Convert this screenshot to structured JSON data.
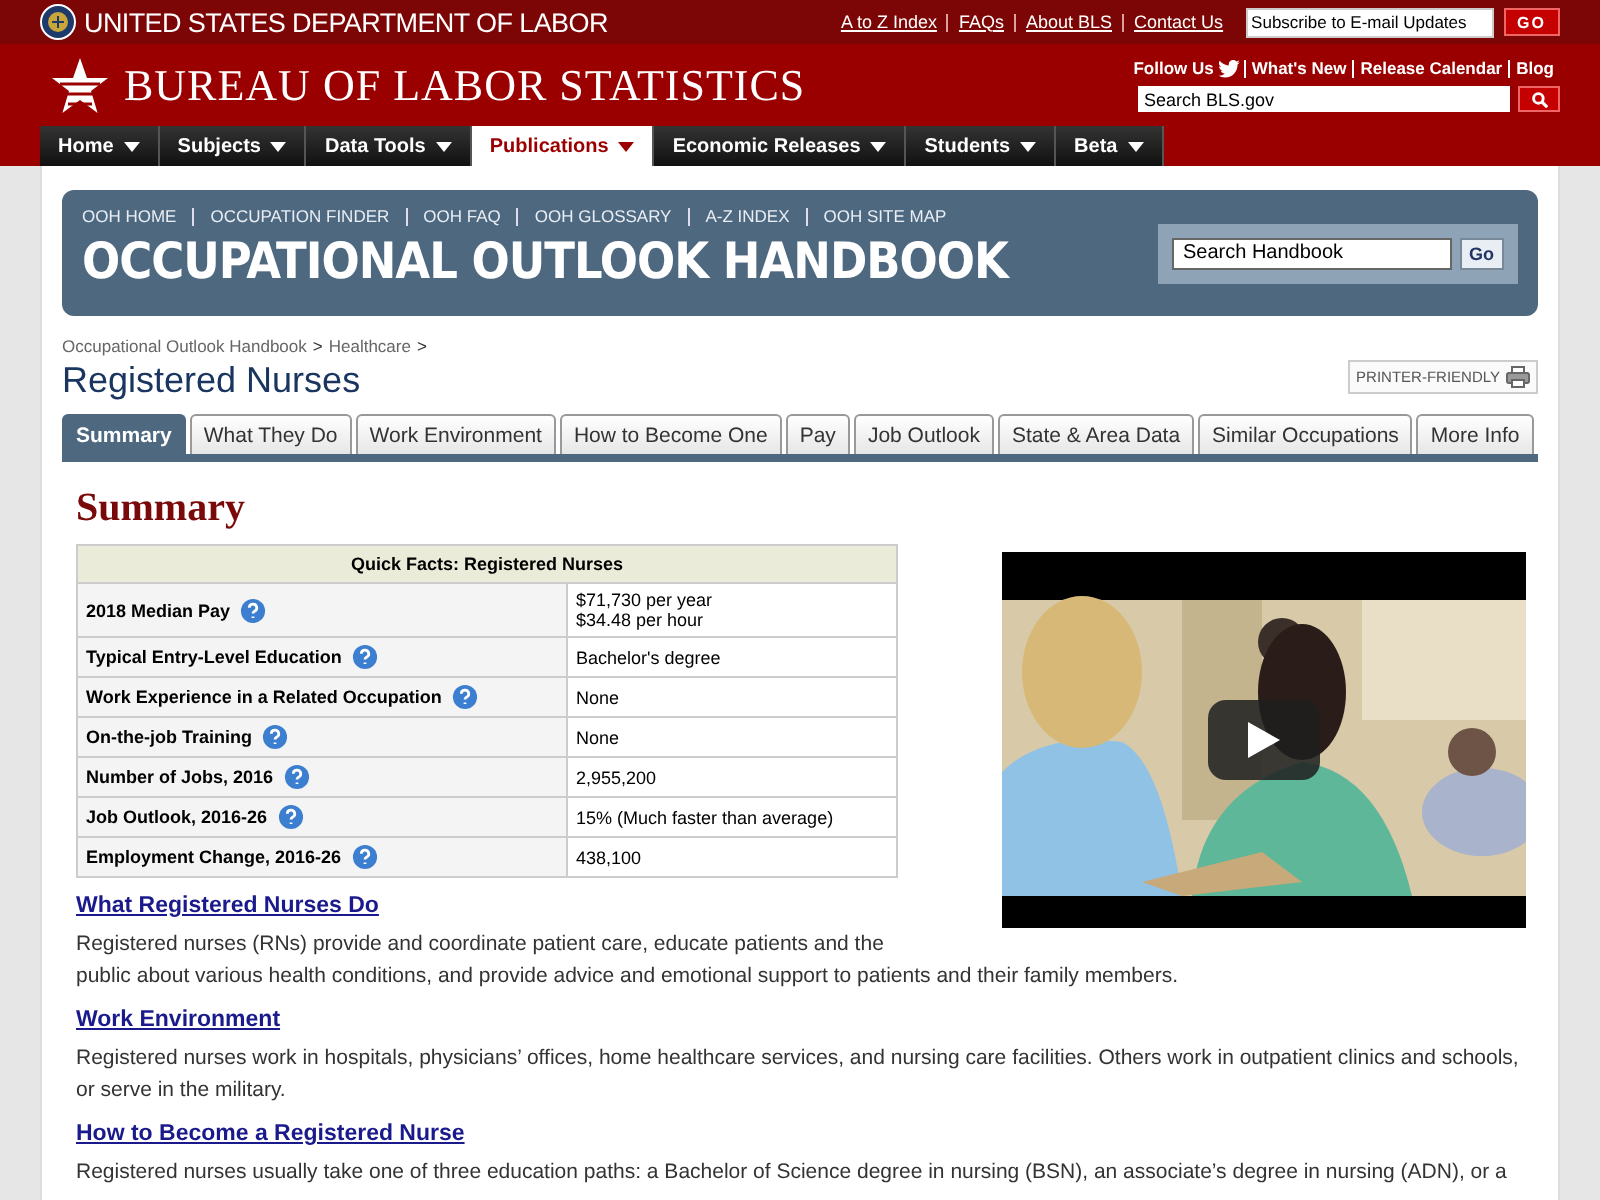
{
  "top_bar": {
    "title": "UNITED STATES DEPARTMENT OF LABOR",
    "links": [
      "A to Z Index",
      "FAQs",
      "About BLS",
      "Contact Us"
    ],
    "subscribe": {
      "placeholder": "Subscribe to E-mail Updates"
    },
    "go_button": "GO"
  },
  "header": {
    "title": "BUREAU OF LABOR STATISTICS",
    "follow": "Follow Us",
    "links": [
      "What's New",
      "Release Calendar",
      "Blog"
    ],
    "search": {
      "placeholder": "Search BLS.gov"
    }
  },
  "nav": [
    {
      "label": "Home",
      "selected": false
    },
    {
      "label": "Subjects",
      "selected": false
    },
    {
      "label": "Data Tools",
      "selected": false
    },
    {
      "label": "Publications",
      "selected": true
    },
    {
      "label": "Economic Releases",
      "selected": false
    },
    {
      "label": "Students",
      "selected": false
    },
    {
      "label": "Beta",
      "selected": false
    }
  ],
  "ooh": {
    "links": [
      "OOH HOME",
      "OCCUPATION FINDER",
      "OOH FAQ",
      "OOH GLOSSARY",
      "A-Z INDEX",
      "OOH SITE MAP"
    ],
    "title": "OCCUPATIONAL OUTLOOK HANDBOOK",
    "search": {
      "value": "Search Handbook"
    },
    "go_button": "Go"
  },
  "breadcrumb": [
    {
      "label": "Occupational Outlook Handbook",
      "separator": ">"
    },
    {
      "label": "Healthcare",
      "separator": ">"
    }
  ],
  "page_title": "Registered Nurses",
  "printer_friendly": "PRINTER-FRIENDLY",
  "tabs": [
    {
      "label": "Summary",
      "selected": true
    },
    {
      "label": "What They Do",
      "selected": false
    },
    {
      "label": "Work Environment",
      "selected": false
    },
    {
      "label": "How to Become One",
      "selected": false
    },
    {
      "label": "Pay",
      "selected": false
    },
    {
      "label": "Job Outlook",
      "selected": false
    },
    {
      "label": "State & Area Data",
      "selected": false
    },
    {
      "label": "Similar Occupations",
      "selected": false
    },
    {
      "label": "More Info",
      "selected": false
    }
  ],
  "summary": {
    "heading": "Summary",
    "quick_facts": {
      "caption": "Quick Facts: Registered Nurses",
      "rows": [
        {
          "label": "2018 Median Pay",
          "value": [
            "$71,730 per year",
            "$34.48 per hour"
          ]
        },
        {
          "label": "Typical Entry-Level Education",
          "value": [
            "Bachelor's degree"
          ]
        },
        {
          "label": "Work Experience in a Related Occupation",
          "value": [
            "None"
          ]
        },
        {
          "label": "On-the-job Training",
          "value": [
            "None"
          ]
        },
        {
          "label": "Number of Jobs, 2016",
          "value": [
            "2,955,200"
          ]
        },
        {
          "label": "Job Outlook, 2016-26",
          "value": [
            "15% (Much faster than average)"
          ]
        },
        {
          "label": "Employment Change, 2016-26",
          "value": [
            "438,100"
          ]
        }
      ]
    }
  },
  "sections": [
    {
      "heading": "What Registered Nurses Do",
      "text": "Registered nurses (RNs) provide and coordinate patient care, educate patients and the public about various health conditions, and provide advice and emotional support to patients and their family members."
    },
    {
      "heading": "Work Environment",
      "text": "Registered nurses work in hospitals, physicians’ offices, home healthcare services, and nursing care facilities. Others work in outpatient clinics and schools, or serve in the military."
    },
    {
      "heading": "How to Become a Registered Nurse",
      "text": "Registered nurses usually take one of three education paths: a Bachelor of Science degree in nursing (BSN), an associate’s degree in nursing (ADN), or a"
    }
  ]
}
